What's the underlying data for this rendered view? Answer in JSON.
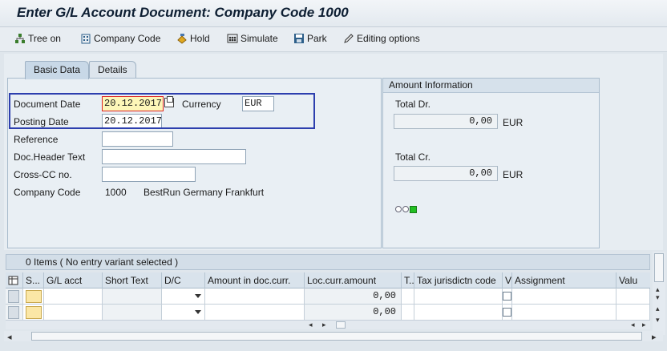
{
  "title": "Enter G/L Account Document: Company Code 1000",
  "toolbar": {
    "tree_on": "Tree on",
    "company_code": "Company Code",
    "hold": "Hold",
    "simulate": "Simulate",
    "park": "Park",
    "editing_options": "Editing options"
  },
  "tabs": [
    "Basic Data",
    "Details"
  ],
  "form": {
    "document_date_label": "Document Date",
    "document_date_value": "20.12.2017",
    "currency_label": "Currency",
    "currency_value": "EUR",
    "posting_date_label": "Posting Date",
    "posting_date_value": "20.12.2017",
    "reference_label": "Reference",
    "reference_value": "",
    "doc_header_label": "Doc.Header Text",
    "doc_header_value": "",
    "cross_cc_label": "Cross-CC no.",
    "cross_cc_value": "",
    "company_code_label": "Company Code",
    "company_code_value": "1000",
    "company_name": "BestRun Germany Frankfurt"
  },
  "amount_info": {
    "header": "Amount Information",
    "total_dr_label": "Total Dr.",
    "total_dr_value": "0,00",
    "total_dr_currency": "EUR",
    "total_cr_label": "Total Cr.",
    "total_cr_value": "0,00",
    "total_cr_currency": "EUR",
    "status_colors": [
      "#ffffff",
      "#ffffff",
      "#22c022"
    ]
  },
  "items": {
    "title": "0 Items ( No entry variant selected )",
    "columns": [
      "S...",
      "G/L acct",
      "Short Text",
      "D/C",
      "Amount in doc.curr.",
      "Loc.curr.amount",
      "T..",
      "Tax jurisdictn code",
      "V",
      "Assignment",
      "Valu"
    ],
    "rows": [
      {
        "loc_amount": "0,00"
      },
      {
        "loc_amount": "0,00"
      }
    ]
  }
}
